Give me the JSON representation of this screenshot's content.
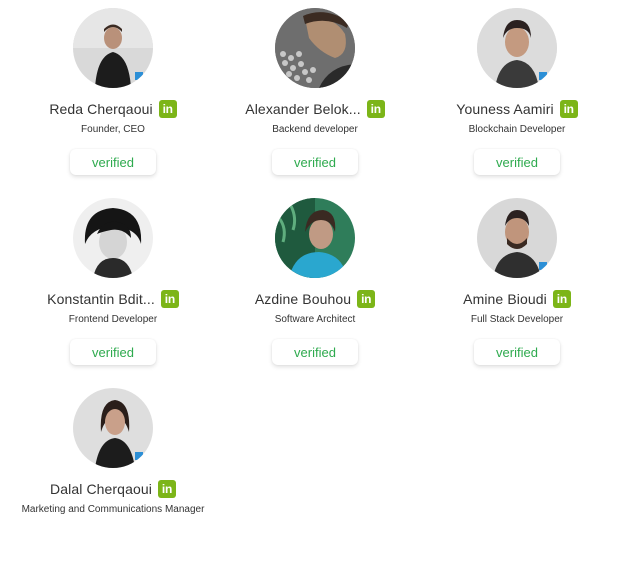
{
  "colors": {
    "accent_green": "#2eaa4e",
    "linkedin_badge": "#7cb518"
  },
  "icons": {
    "linkedin": "linkedin-icon"
  },
  "members": [
    {
      "name": "Reda Cherqaoui",
      "role": "Founder, CEO",
      "status": "verified",
      "linkedin_label": "in"
    },
    {
      "name": "Alexander Belok...",
      "role": "Backend developer",
      "status": "verified",
      "linkedin_label": "in"
    },
    {
      "name": "Youness Aamiri",
      "role": "Blockchain Developer",
      "status": "verified",
      "linkedin_label": "in"
    },
    {
      "name": "Konstantin Bdit...",
      "role": "Frontend Developer",
      "status": "verified",
      "linkedin_label": "in"
    },
    {
      "name": "Azdine Bouhou",
      "role": "Software Architect",
      "status": "verified",
      "linkedin_label": "in"
    },
    {
      "name": "Amine Bioudi",
      "role": "Full Stack Developer",
      "status": "verified",
      "linkedin_label": "in"
    },
    {
      "name": "Dalal Cherqaoui",
      "role": "Marketing and Communications Manager",
      "linkedin_label": "in"
    }
  ]
}
